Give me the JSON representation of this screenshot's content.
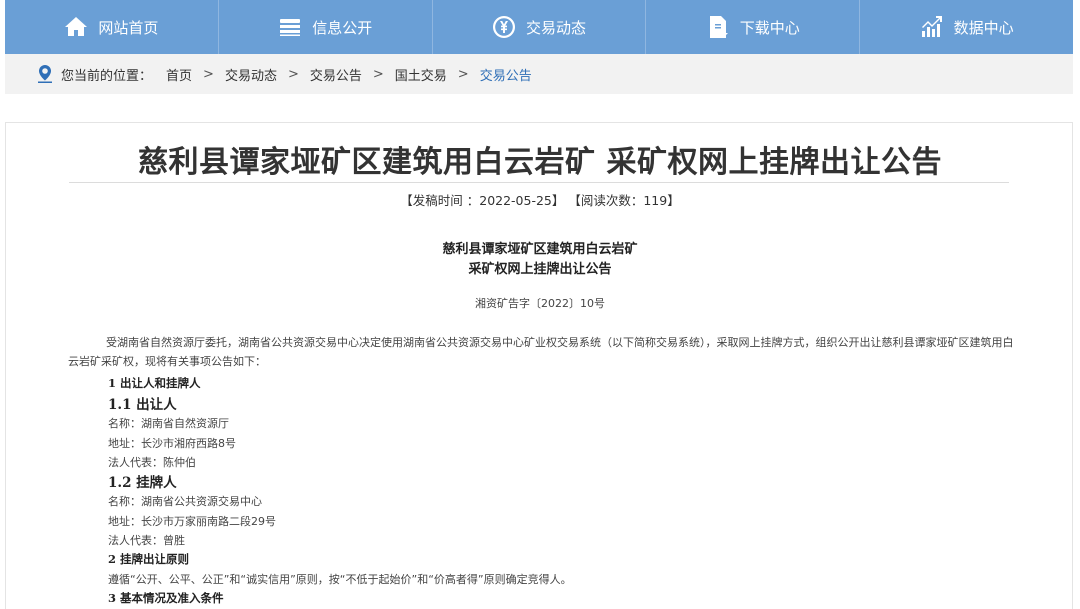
{
  "nav": {
    "items": [
      {
        "label": "网站首页",
        "icon": "home-icon"
      },
      {
        "label": "信息公开",
        "icon": "list-icon"
      },
      {
        "label": "交易动态",
        "icon": "yen-icon"
      },
      {
        "label": "下载中心",
        "icon": "download-icon"
      },
      {
        "label": "数据中心",
        "icon": "chart-icon"
      }
    ]
  },
  "breadcrumb": {
    "prefix": "您当前的位置：",
    "items": [
      "首页",
      "交易动态",
      "交易公告",
      "国土交易",
      "交易公告"
    ],
    "separator": ">"
  },
  "article": {
    "title": "慈利县谭家垭矿区建筑用白云岩矿 采矿权网上挂牌出让公告",
    "meta": "【发稿时间 ：2022-05-25】 【阅读次数：119】",
    "doc_title_line1": "慈利县谭家垭矿区建筑用白云岩矿",
    "doc_title_line2": "采矿权网上挂牌出让公告",
    "doc_number": "湘资矿告字〔2022〕10号",
    "intro": "受湖南省自然资源厅委托，湖南省公共资源交易中心决定使用湖南省公共资源交易中心矿业权交易系统（以下简称交易系统），采取网上挂牌方式，组织公开出让慈利县谭家垭矿区建筑用白云岩矿采矿权，现将有关事项公告如下：",
    "s1": "1 出让人和挂牌人",
    "s1_1": "1.1 出让人",
    "s1_1_name": "名称：湖南省自然资源厅",
    "s1_1_addr": "地址：长沙市湘府西路8号",
    "s1_1_rep": "法人代表：陈仲伯",
    "s1_2": "1.2 挂牌人",
    "s1_2_name": "名称：湖南省公共资源交易中心",
    "s1_2_addr": "地址：长沙市万家丽南路二段29号",
    "s1_2_rep": "法人代表：曾胜",
    "s2": "2 挂牌出让原则",
    "s2_text": "遵循“公开、公平、公正”和“诚实信用”原则，按“不低于起始价”和“价高者得”原则确定竞得人。",
    "s3": "3 基本情况及准入条件"
  },
  "colors": {
    "nav": "#6a9fd6",
    "accent": "#2f6fb7",
    "crumb_bg": "#f2f2f2"
  }
}
